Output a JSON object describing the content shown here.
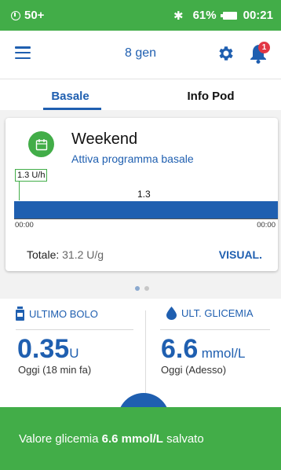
{
  "status_bar": {
    "notification_count": "50+",
    "battery_percent": "61%",
    "time": "00:21",
    "icons": [
      "sim-icon",
      "bluetooth-icon",
      "battery-charging-icon"
    ]
  },
  "app_bar": {
    "date": "8 gen",
    "notification_badge": "1",
    "icons": [
      "menu-icon",
      "gear-icon",
      "bell-icon"
    ]
  },
  "tabs": [
    {
      "label": "Basale",
      "active": true
    },
    {
      "label": "Info Pod",
      "active": false
    }
  ],
  "basal_card": {
    "program_name": "Weekend",
    "action_label": "Attiva programma basale",
    "current_rate_label": "1.3 U/h",
    "bar_value_label": "1.3",
    "time_start": "00:00",
    "time_end": "00:00",
    "total_label": "Totale:",
    "total_value": "31.2 U/g",
    "view_link": "VISUAL."
  },
  "pager": {
    "pages": 2,
    "active_index": 0
  },
  "last_bolus": {
    "title": "ULTIMO BOLO",
    "value": "0.35",
    "unit": "U",
    "subtitle": "Oggi (18 min fa)"
  },
  "last_glucose": {
    "title": "ULT. GLICEMIA",
    "value": "6.6",
    "unit": "mmol/L",
    "subtitle": "Oggi (Adesso)"
  },
  "snackbar": {
    "prefix": "Valore glicemia",
    "value": "6.6 mmol/L",
    "suffix": "salvato"
  },
  "colors": {
    "green": "#42ad48",
    "blue": "#1f5fb0",
    "badge_red": "#e23744"
  }
}
